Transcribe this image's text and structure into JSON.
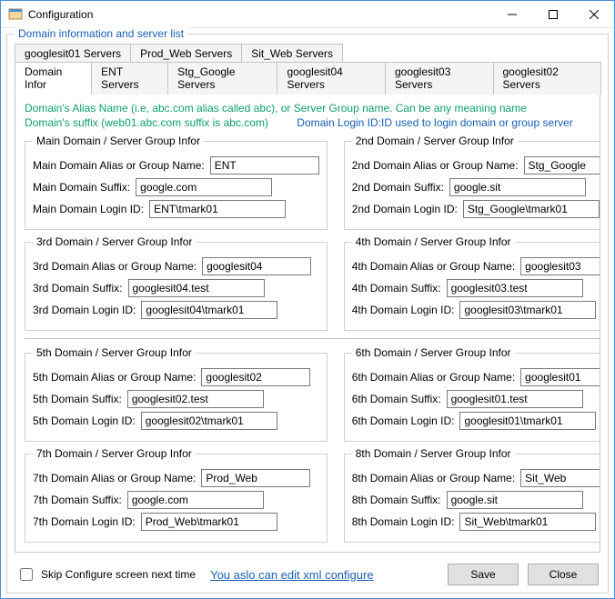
{
  "window": {
    "title": "Configuration"
  },
  "group_legend": "Domain information and server list",
  "tabs_row1": [
    {
      "label": "googlesit01 Servers"
    },
    {
      "label": "Prod_Web Servers"
    },
    {
      "label": "Sit_Web Servers"
    }
  ],
  "tabs_row2": [
    {
      "label": "Domain Infor",
      "active": true
    },
    {
      "label": "ENT Servers"
    },
    {
      "label": "Stg_Google Servers"
    },
    {
      "label": "googlesit04 Servers"
    },
    {
      "label": "googlesit03 Servers"
    },
    {
      "label": "googlesit02 Servers"
    }
  ],
  "hints": {
    "line1": "Domain's Alias Name (i.e, abc.com alias called abc), or Server Group name. Can be any meaning name",
    "line2a": "Domain's suffix (web01.abc.com suffix is abc.com)",
    "line2b": "Domain Login ID:ID used to login domain or group server"
  },
  "labels": {
    "alias": "Domain Alias or Group Name:",
    "suffix": "Domain Suffix:",
    "login": "Domain Login ID:"
  },
  "domains": [
    {
      "ord": "Main",
      "legend": "Main Domain / Server Group Infor",
      "alias": "ENT",
      "suffix": "google.com",
      "login": "ENT\\tmark01"
    },
    {
      "ord": "2nd",
      "legend": "2nd Domain / Server Group Infor",
      "alias": "Stg_Google",
      "suffix": "google.sit",
      "login": "Stg_Google\\tmark01"
    },
    {
      "ord": "3rd",
      "legend": "3rd Domain / Server Group Infor",
      "alias": "googlesit04",
      "suffix": "googlesit04.test",
      "login": "googlesit04\\tmark01"
    },
    {
      "ord": "4th",
      "legend": "4th Domain / Server Group Infor",
      "alias": "googlesit03",
      "suffix": "googlesit03.test",
      "login": "googlesit03\\tmark01"
    },
    {
      "ord": "5th",
      "legend": "5th Domain / Server Group Infor",
      "alias": "googlesit02",
      "suffix": "googlesit02.test",
      "login": "googlesit02\\tmark01"
    },
    {
      "ord": "6th",
      "legend": "6th Domain / Server Group Infor",
      "alias": "googlesit01",
      "suffix": "googlesit01.test",
      "login": "googlesit01\\tmark01"
    },
    {
      "ord": "7th",
      "legend": "7th Domain / Server Group Infor",
      "alias": "Prod_Web",
      "suffix": "google.com",
      "login": "Prod_Web\\tmark01"
    },
    {
      "ord": "8th",
      "legend": "8th Domain / Server Group Infor",
      "alias": "Sit_Web",
      "suffix": "google.sit",
      "login": "Sit_Web\\tmark01"
    }
  ],
  "footer": {
    "skip_label": "Skip Configure screen next time",
    "link": "You aslo can edit xml configure",
    "save": "Save",
    "close": "Close"
  }
}
